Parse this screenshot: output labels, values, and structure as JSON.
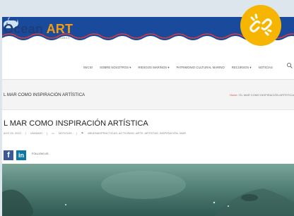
{
  "site": {
    "logo_main": "Ocean ",
    "logo_accent": "ART",
    "logo_sub": "PROJECT"
  },
  "nav": {
    "items": [
      "INICIO",
      "SOBRE NOSOTROS ▾",
      "RIESGOS MARINOS ▾",
      "PATRIMONIO CULTURAL MARINO",
      "RECURSOS ▾",
      "NOTICIAS"
    ]
  },
  "page_header": {
    "title": "L MAR COMO INSPIRACIÓN ARTÍSTICA",
    "breadcrumb_home": "Home",
    "breadcrumb_sep": " / ",
    "breadcrumb_current": "EL MAR COMO INSPIRACIÓN ARTÍSTICA"
  },
  "post": {
    "title": "L MAR COMO INSPIRACIÓN ARTÍSTICA",
    "date": "AYO 15, 2022",
    "author": "VANAMO",
    "category": "NOTICIAS",
    "tags": "#BUENASPRACTICAS, ACTIVISMO, ARTE, ARTISTAS, INSPIRACIÓN, MAR"
  },
  "social": {
    "fb": "f",
    "in": "in",
    "follow": "FOLLOW US"
  },
  "colors": {
    "banner": "#1a4a9b",
    "accent": "#f39c12",
    "badge": "#f6b500"
  },
  "icons": [
    "whale-icon",
    "search-icon",
    "link-icon",
    "facebook-icon",
    "linkedin-icon"
  ]
}
